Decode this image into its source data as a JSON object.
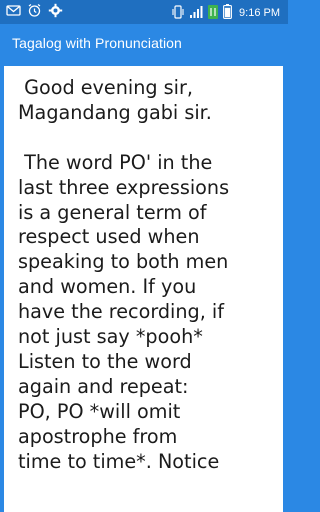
{
  "status_bar": {
    "time": "9:16 PM",
    "icons": [
      "email-icon",
      "alarm-icon",
      "settings-icon",
      "vibrate-icon",
      "signal-icon",
      "network-4g-icon",
      "battery-icon"
    ]
  },
  "app_bar": {
    "title": "Tagalog with Pronunciation"
  },
  "content": {
    "text": " Good evening sir,\nMagandang gabi sir.\n\n The word PO' in the\nlast three expressions\nis a general term of\nrespect used when\nspeaking to both men\nand women. If you\nhave the recording, if\nnot just say *pooh*\nListen to the word\nagain and repeat:\nPO, PO *will omit\napostrophe from\ntime to time*. Notice"
  },
  "colors": {
    "status_bar_bg": "#1f6fc0",
    "app_bar_bg": "#2b88e4",
    "card_bg": "#ffffff",
    "text": "#1b1b1b"
  }
}
